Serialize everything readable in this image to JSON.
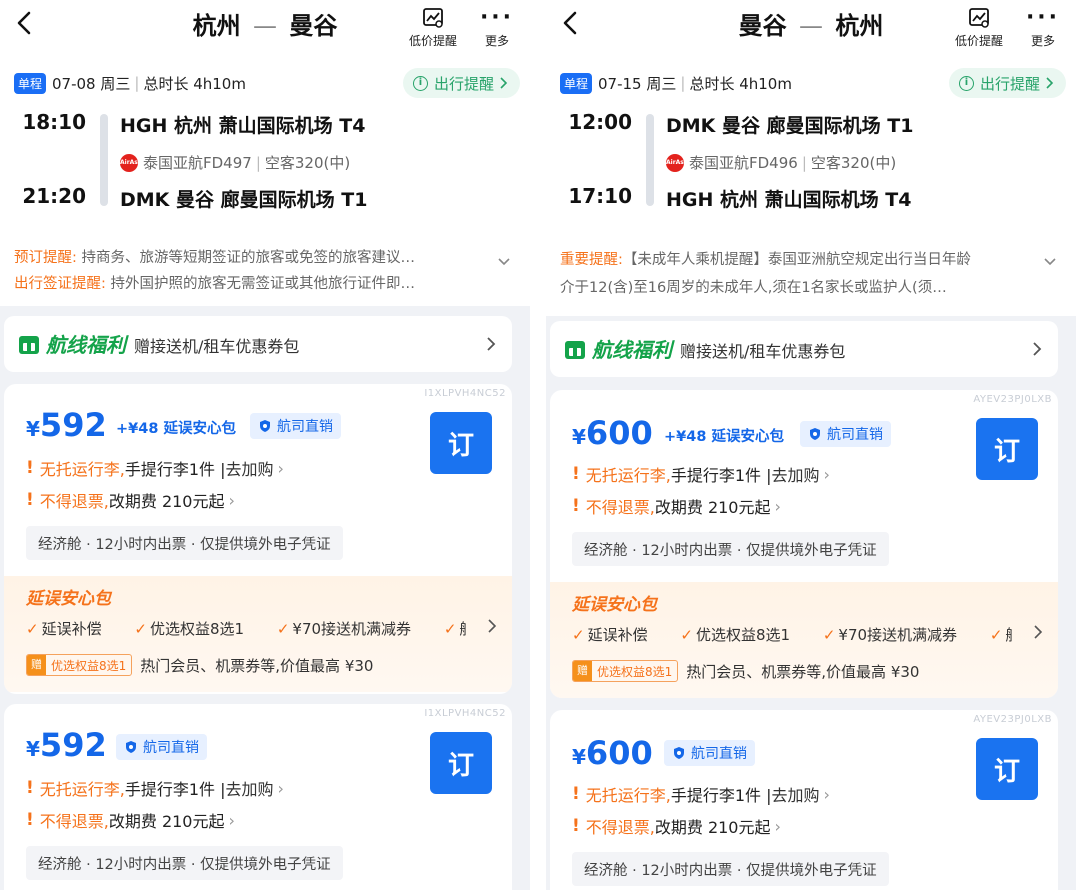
{
  "panels": [
    {
      "title_from": "杭州",
      "title_dash": "—",
      "title_to": "曼谷",
      "tool_alert_label": "低价提醒",
      "tool_more_label": "更多",
      "trip_badge": "单程",
      "trip_date": "07-08 周三",
      "trip_sep": "|",
      "trip_duration": "总时长 4h10m",
      "travel_tip": "出行提醒",
      "dep_time": "18:10",
      "dep_airport": "HGH  杭州 萧山国际机场 T4",
      "airline_logo_text": "AirAsia",
      "airline": "泰国亚航FD497",
      "aircraft": "空客320(中)",
      "arr_time": "21:20",
      "arr_airport": "DMK  曼谷 廊曼国际机场 T1",
      "notice1_key": "预订提醒:",
      "notice1_text": " 持商务、旅游等短期签证的旅客或免签的旅客建议…",
      "notice2_key": "出行签证提醒:",
      "notice2_text": " 持外国护照的旅客无需签证或其他旅行证件即…",
      "benefit_title": "航线福利",
      "benefit_desc": "赠接送机/租车优惠券包",
      "offers": [
        {
          "code": "I1XLPVH4NC52",
          "currency": "¥",
          "price": "592",
          "addon": "+¥48 延误安心包",
          "badge": "航司直销",
          "book": "订",
          "rule1_warn": "无托运行李,",
          "rule1_text": "手提行李1件 | ",
          "rule1_link": "去加购",
          "rule2_warn": "不得退票,",
          "rule2_text": "改期费 210元起",
          "cabin": "经济舱 · 12小时内出票 · 仅提供境外电子凭证",
          "pkg_title": "延误安心包",
          "pkg_items": [
            "延误补偿",
            "优选权益8选1",
            "¥70接送机满减券",
            "航班"
          ],
          "gift_z": "赠",
          "gift_tag": "优选权益8选1",
          "gift_desc": "热门会员、机票券等,价值最高 ¥30"
        },
        {
          "code": "I1XLPVH4NC52",
          "currency": "¥",
          "price": "592",
          "badge": "航司直销",
          "book": "订",
          "rule1_warn": "无托运行李,",
          "rule1_text": "手提行李1件 | ",
          "rule1_link": "去加购",
          "rule2_warn": "不得退票,",
          "rule2_text": "改期费 210元起",
          "cabin": "经济舱 · 12小时内出票 · 仅提供境外电子凭证"
        }
      ]
    },
    {
      "title_from": "曼谷",
      "title_dash": "—",
      "title_to": "杭州",
      "tool_alert_label": "低价提醒",
      "tool_more_label": "更多",
      "trip_badge": "单程",
      "trip_date": "07-15 周三",
      "trip_sep": "|",
      "trip_duration": "总时长 4h10m",
      "travel_tip": "出行提醒",
      "dep_time": "12:00",
      "dep_airport": "DMK  曼谷 廊曼国际机场 T1",
      "airline_logo_text": "AirAsia",
      "airline": "泰国亚航FD496",
      "aircraft": "空客320(中)",
      "arr_time": "17:10",
      "arr_airport": "HGH  杭州 萧山国际机场 T4",
      "notice1_key": "重要提醒:",
      "notice1_text": "【未成年人乘机提醒】泰国亚洲航空规定出行当日年龄",
      "notice2_key": "",
      "notice2_text": "介于12(含)至16周岁的未成年人,须在1名家长或监护人(须…",
      "benefit_title": "航线福利",
      "benefit_desc": "赠接送机/租车优惠券包",
      "offers": [
        {
          "code": "AYEV23PJ0LXB",
          "currency": "¥",
          "price": "600",
          "addon": "+¥48 延误安心包",
          "badge": "航司直销",
          "book": "订",
          "rule1_warn": "无托运行李,",
          "rule1_text": "手提行李1件 | ",
          "rule1_link": "去加购",
          "rule2_warn": "不得退票,",
          "rule2_text": "改期费 210元起",
          "cabin": "经济舱 · 12小时内出票 · 仅提供境外电子凭证",
          "pkg_title": "延误安心包",
          "pkg_items": [
            "延误补偿",
            "优选权益8选1",
            "¥70接送机满减券",
            "航班"
          ],
          "gift_z": "赠",
          "gift_tag": "优选权益8选1",
          "gift_desc": "热门会员、机票券等,价值最高 ¥30"
        },
        {
          "code": "AYEV23PJ0LXB",
          "currency": "¥",
          "price": "600",
          "badge": "航司直销",
          "book": "订",
          "rule1_warn": "无托运行李,",
          "rule1_text": "手提行李1件 | ",
          "rule1_link": "去加购",
          "rule2_warn": "不得退票,",
          "rule2_text": "改期费 210元起",
          "cabin": "经济舱 · 12小时内出票 · 仅提供境外电子凭证"
        }
      ]
    }
  ],
  "colors": {
    "accent_blue": "#1467e8",
    "warn_orange": "#f5721b",
    "benefit_green": "#14a34a",
    "tip_green": "#28a36a"
  },
  "icons": {
    "back": "chevron-left-icon",
    "alert": "price-trend-icon",
    "more": "more-dots-icon",
    "info": "info-circle-icon",
    "gift": "gift-box-icon",
    "shield": "shield-badge-icon",
    "check": "check-icon",
    "chevron": "chevron-right-icon",
    "expand": "chevron-down-icon"
  }
}
